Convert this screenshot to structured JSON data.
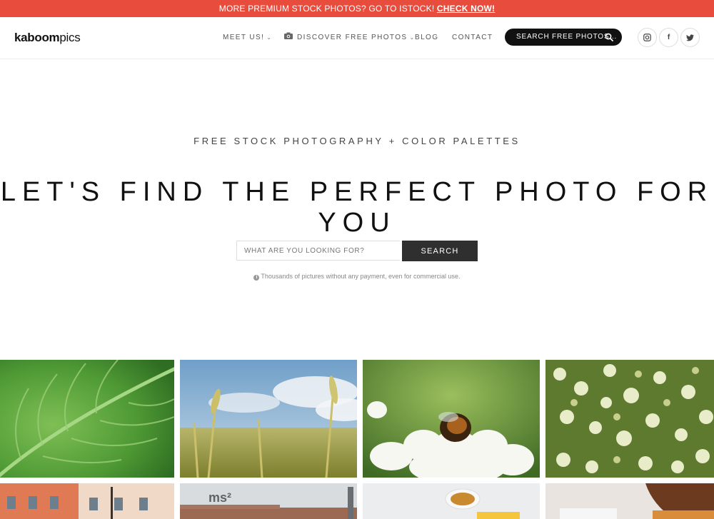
{
  "promo": {
    "text": "MORE PREMIUM STOCK PHOTOS? GO TO ISTOCK! ",
    "link": "CHECK NOW!"
  },
  "header": {
    "logo_bold": "kaboom",
    "logo_light": "pics",
    "nav": [
      {
        "label": "MEET US!",
        "chevron": true
      },
      {
        "label": "DISCOVER FREE PHOTOS",
        "chevron": true,
        "icon": "camera-icon"
      },
      {
        "label": "BLOG",
        "chevron": false
      },
      {
        "label": "CONTACT",
        "chevron": false
      }
    ],
    "search_label": "SEARCH FREE PHOTOS...",
    "social": [
      {
        "icon": "instagram-icon",
        "glyph": "◎"
      },
      {
        "icon": "facebook-icon",
        "glyph": "f"
      },
      {
        "icon": "twitter-icon",
        "glyph": "t"
      }
    ]
  },
  "hero": {
    "tagline": "FREE STOCK PHOTOGRAPHY + COLOR PALETTES",
    "headline": "LET'S FIND THE PERFECT PHOTO FOR YOU",
    "search_placeholder": "WHAT ARE YOU LOOKING FOR?",
    "search_button": "SEARCH",
    "note": "Thousands of pictures without any payment, even for commercial use."
  },
  "gallery": {
    "photos": [
      {
        "subject": "green leaf"
      },
      {
        "subject": "wheat field"
      },
      {
        "subject": "bee on flower"
      },
      {
        "subject": "white blossoms"
      },
      {
        "subject": "building facade"
      },
      {
        "subject": "industrial building"
      },
      {
        "subject": "coffee cup"
      },
      {
        "subject": "person at desk"
      }
    ]
  }
}
